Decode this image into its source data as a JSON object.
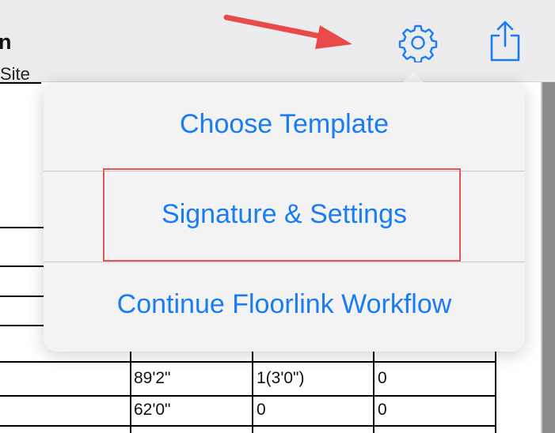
{
  "header": {
    "title_fragment": "n",
    "settings_icon": "gear-icon",
    "share_icon": "share-icon"
  },
  "document": {
    "site_fragment": "Site",
    "rows": [
      {
        "length": "89'2\"",
        "count": "1(3'0\")",
        "extra": "0"
      },
      {
        "length": "62'0\"",
        "count": "0",
        "extra": "0"
      }
    ]
  },
  "menu": {
    "items": [
      {
        "label": "Choose Template"
      },
      {
        "label": "Signature & Settings"
      },
      {
        "label": "Continue Floorlink Workflow"
      }
    ],
    "highlighted": "Signature & Settings"
  },
  "annotation": {
    "arrow_color": "#e84a4a",
    "box_color": "#e35757"
  },
  "colors": {
    "accent": "#1a7cf5",
    "bar_background": "#ececee",
    "popover_background": "#f3f3f4"
  }
}
